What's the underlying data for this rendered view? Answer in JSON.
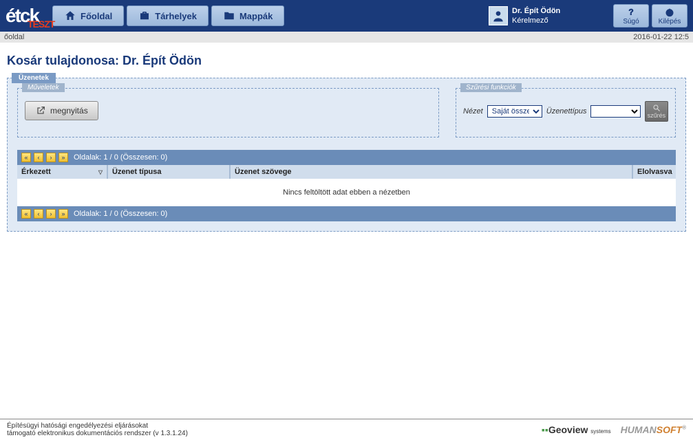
{
  "header": {
    "logo": "étck",
    "logo_overlay": "TESZT",
    "nav": [
      {
        "label": "Főoldal",
        "icon": "home"
      },
      {
        "label": "Tárhelyek",
        "icon": "briefcase"
      },
      {
        "label": "Mappák",
        "icon": "folder"
      }
    ],
    "user": {
      "name": "Dr. Épít Ödön",
      "role": "Kérelmező"
    },
    "help_label": "Súgó",
    "logout_label": "Kilépés"
  },
  "breadcrumb": {
    "path": "őoldal",
    "timestamp": "2016-01-22 12:5"
  },
  "page_title": "Kosár tulajdonosa: Dr. Épít Ödön",
  "messages_panel": {
    "legend": "Üzenetek",
    "operations_legend": "Műveletek",
    "open_label": "megnyitás",
    "filter_legend": "Szűrési funkciók",
    "view_label": "Nézet",
    "view_value": "Saját összes",
    "type_label": "Üzenettípus",
    "type_value": "",
    "filter_label": "szűrés"
  },
  "table": {
    "pager_text": "Oldalak: 1 / 0 (Összesen: 0)",
    "columns": [
      "Érkezett",
      "Üzenet típusa",
      "Üzenet szövege",
      "Elolvasva"
    ],
    "empty_text": "Nincs feltöltött adat ebben a nézetben"
  },
  "footer": {
    "line1": "Építésügyi hatósági engedélyezési eljárásokat",
    "line2": "támogató elektronikus dokumentációs rendszer (v 1.3.1.24)",
    "logo1": "Geoview",
    "logo1_sub": "systems",
    "logo2_a": "HUMAN",
    "logo2_b": "SOFT"
  }
}
